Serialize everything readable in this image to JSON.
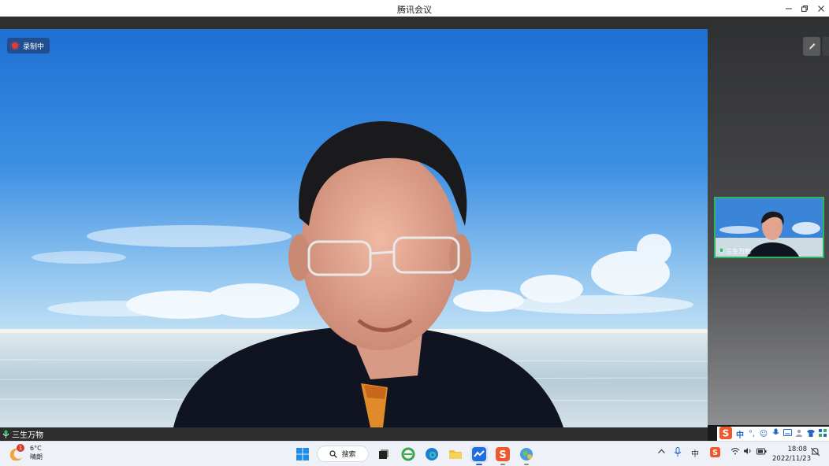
{
  "window": {
    "title": "腾讯会议"
  },
  "recording": {
    "label": "录制中"
  },
  "main_video": {
    "participant_name": "三生万物"
  },
  "thumbnail": {
    "participant_name": "三生万物"
  },
  "ime": {
    "items": [
      "S",
      "中",
      "°,",
      "☺",
      "mic",
      "kbd",
      "person",
      "shirt",
      "grid"
    ]
  },
  "taskbar": {
    "weather": {
      "temp": "6°C",
      "condition": "晴朗",
      "badge": "1"
    },
    "search_label": "搜索",
    "ime_indicator": "中",
    "time": "18:08",
    "date": "2022/11/23"
  },
  "colors": {
    "accent_green": "#2bb860",
    "recording_badge": "#1f4f8e",
    "recording_dot": "#e03c3c"
  }
}
